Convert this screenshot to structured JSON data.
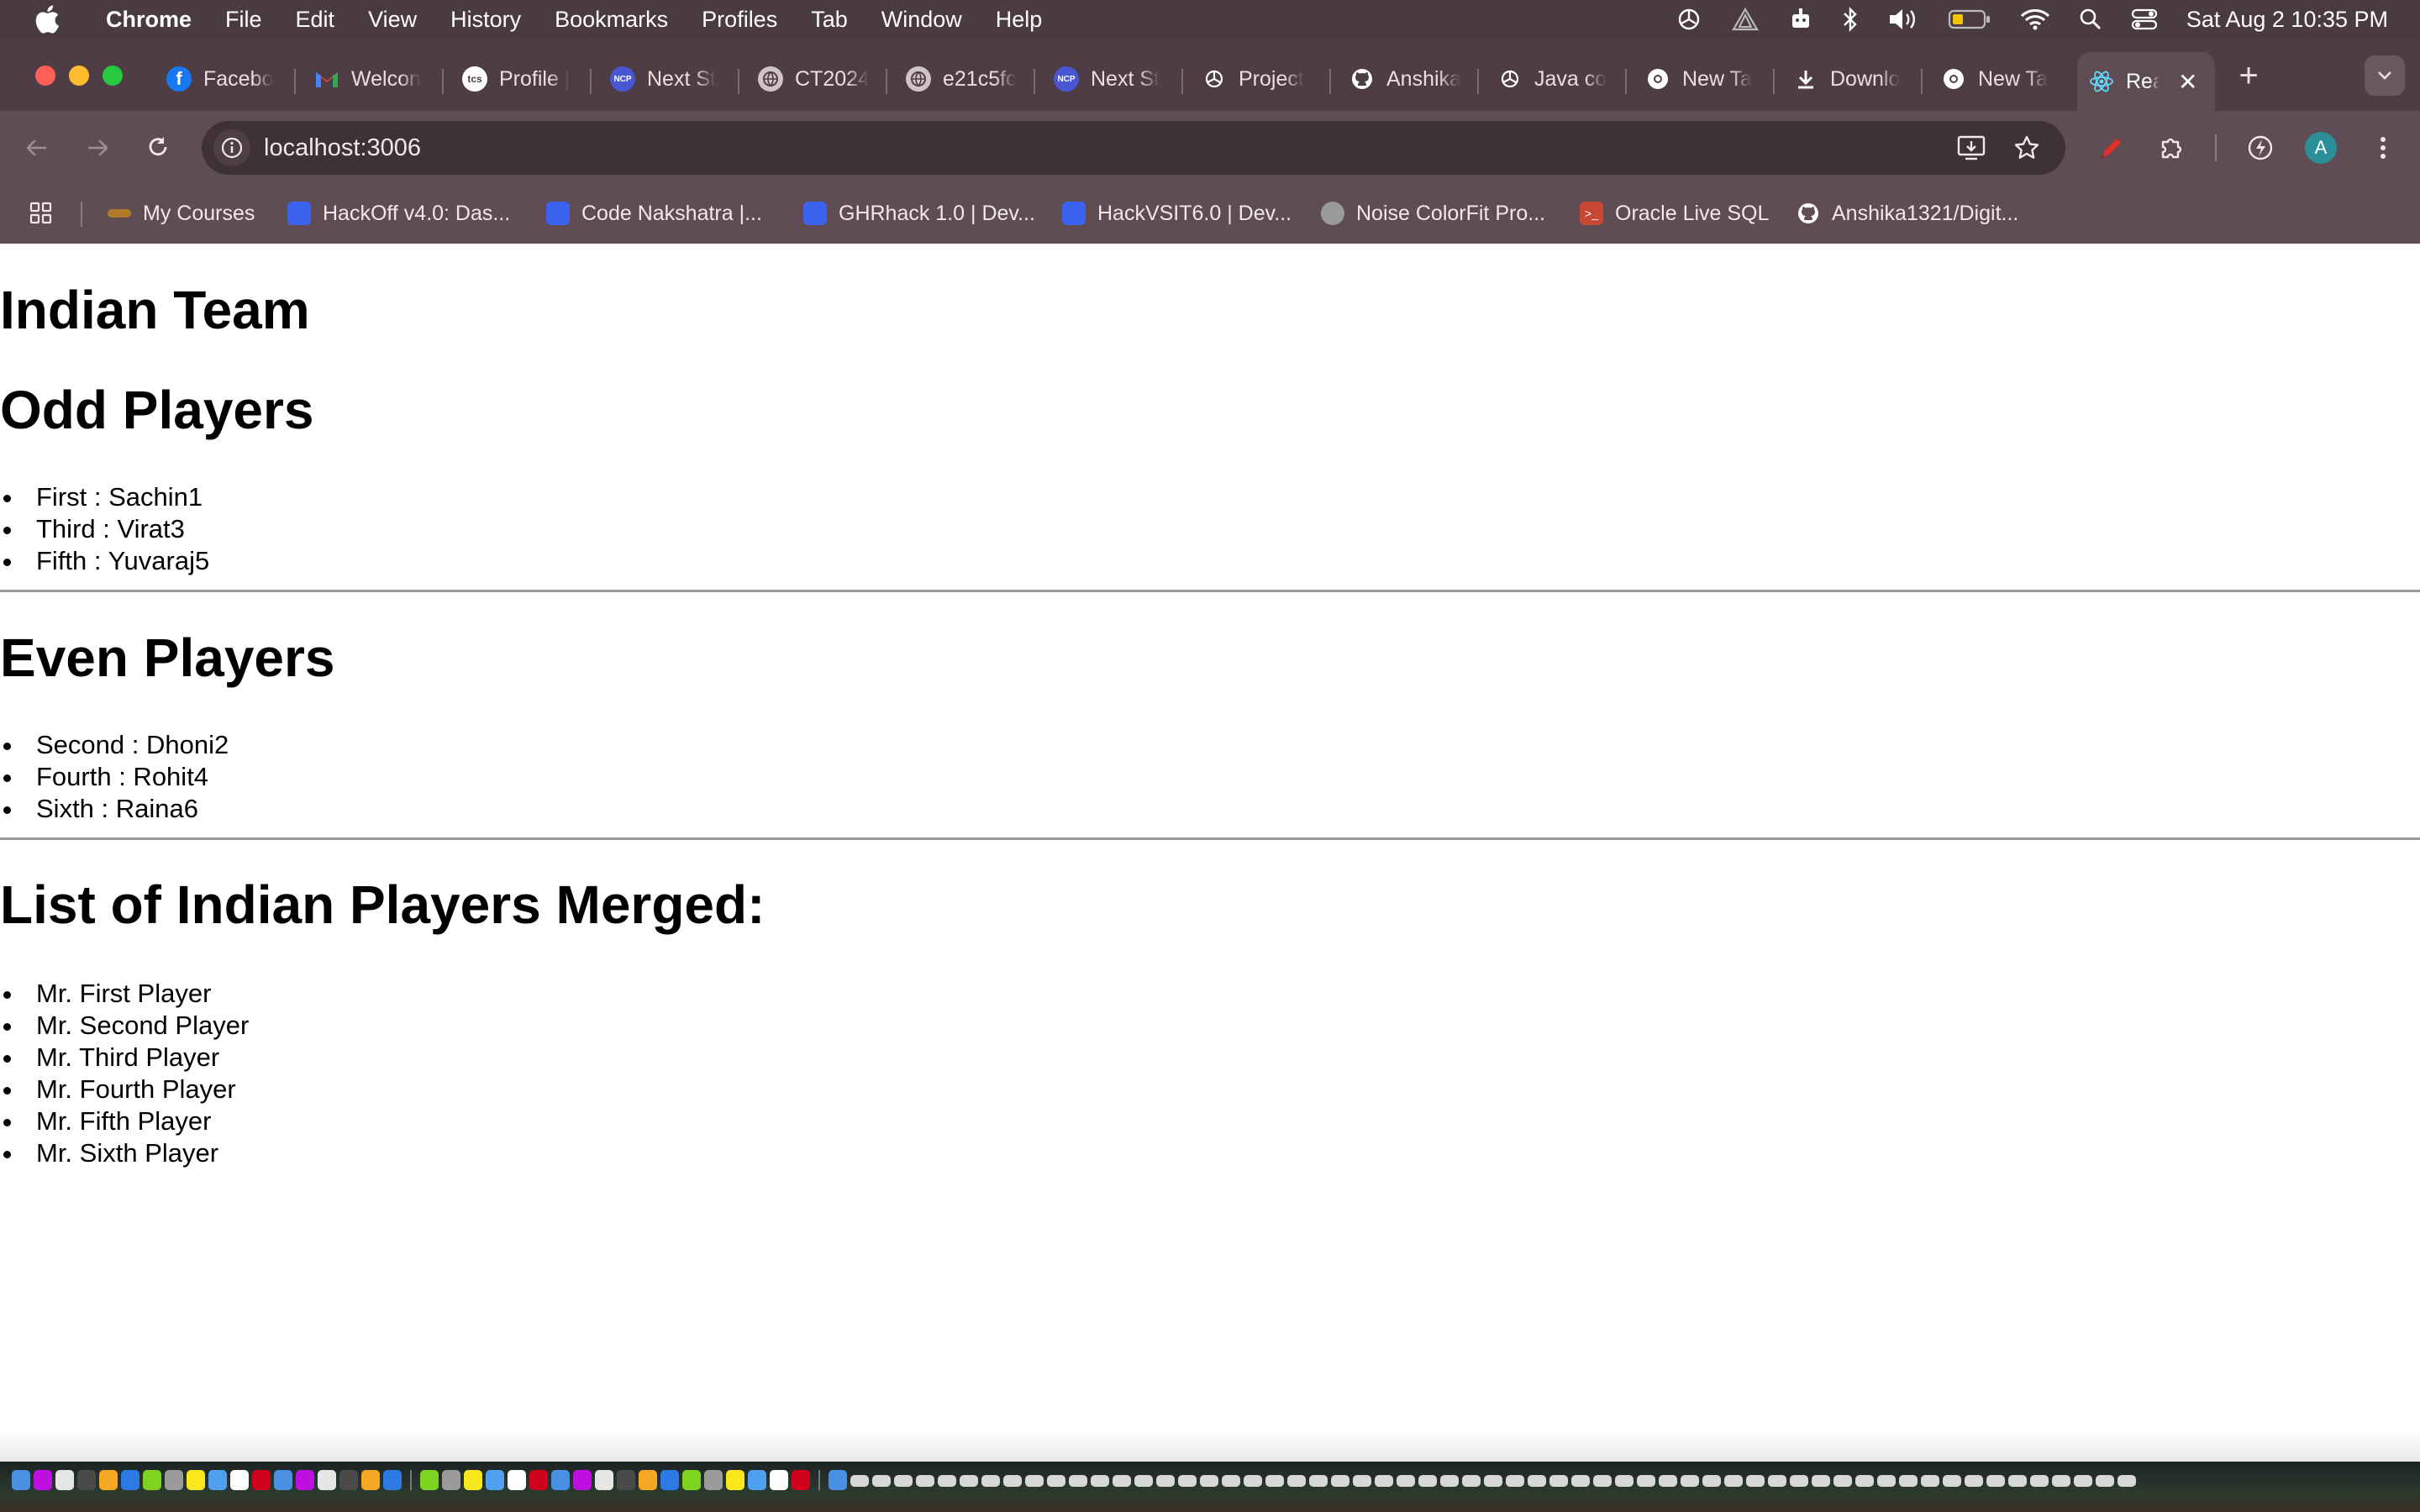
{
  "menubar": {
    "app_name": "Chrome",
    "items": [
      "File",
      "Edit",
      "View",
      "History",
      "Bookmarks",
      "Profiles",
      "Tab",
      "Window",
      "Help"
    ],
    "clock": "Sat Aug 2  10:35 PM"
  },
  "tabs": [
    {
      "title": "Facebo",
      "favicon": "facebook-icon",
      "color": "#1877f2"
    },
    {
      "title": "Welcon",
      "favicon": "gmail-icon",
      "color": "#ea4335"
    },
    {
      "title": "Profile |",
      "favicon": "tcs-icon",
      "color": "#ffffff"
    },
    {
      "title": "Next St",
      "favicon": "ncp-icon",
      "color": "#4a55d4"
    },
    {
      "title": "CT2024",
      "favicon": "globe-icon",
      "color": "#cfc3c8"
    },
    {
      "title": "e21c5fc",
      "favicon": "globe-icon",
      "color": "#cfc3c8"
    },
    {
      "title": "Next St",
      "favicon": "ncp-icon",
      "color": "#4a55d4"
    },
    {
      "title": "Project",
      "favicon": "openai-icon",
      "color": "#ffffff"
    },
    {
      "title": "Anshika",
      "favicon": "github-icon",
      "color": "#ffffff"
    },
    {
      "title": "Java co",
      "favicon": "openai-icon",
      "color": "#ffffff"
    },
    {
      "title": "New Ta",
      "favicon": "chrome-icon",
      "color": "#ffffff"
    },
    {
      "title": "Downlo",
      "favicon": "download-icon",
      "color": "#ffffff"
    },
    {
      "title": "New Ta",
      "favicon": "chrome-icon",
      "color": "#ffffff"
    },
    {
      "title": "Rea",
      "favicon": "react-icon",
      "color": "#61dafb",
      "active": true
    }
  ],
  "toolbar": {
    "url": "localhost:3006",
    "profile_initial": "A"
  },
  "bookmarks": [
    {
      "label": "My Courses",
      "color": "#b07a2a"
    },
    {
      "label": "HackOff v4.0: Das...",
      "color": "#3b63f0"
    },
    {
      "label": "Code Nakshatra |...",
      "color": "#3b63f0"
    },
    {
      "label": "GHRhack 1.0 | Dev...",
      "color": "#3b63f0"
    },
    {
      "label": "HackVSIT6.0 | Dev...",
      "color": "#3b63f0"
    },
    {
      "label": "Noise ColorFit Pro...",
      "color": "#9a9a9a"
    },
    {
      "label": "Oracle Live SQL",
      "color": "#c74634"
    },
    {
      "label": "Anshika1321/Digit...",
      "color": "#ffffff"
    }
  ],
  "page": {
    "title": "Indian Team",
    "odd_heading": "Odd Players",
    "odd_players": [
      "First : Sachin1",
      "Third : Virat3",
      "Fifth : Yuvaraj5"
    ],
    "even_heading": "Even Players",
    "even_players": [
      "Second : Dhoni2",
      "Fourth : Rohit4",
      "Sixth : Raina6"
    ],
    "merged_heading": "List of Indian Players Merged:",
    "merged_players": [
      "Mr. First Player",
      "Mr. Second Player",
      "Mr. Third Player",
      "Mr. Fourth Player",
      "Mr. Fifth Player",
      "Mr. Sixth Player"
    ]
  }
}
